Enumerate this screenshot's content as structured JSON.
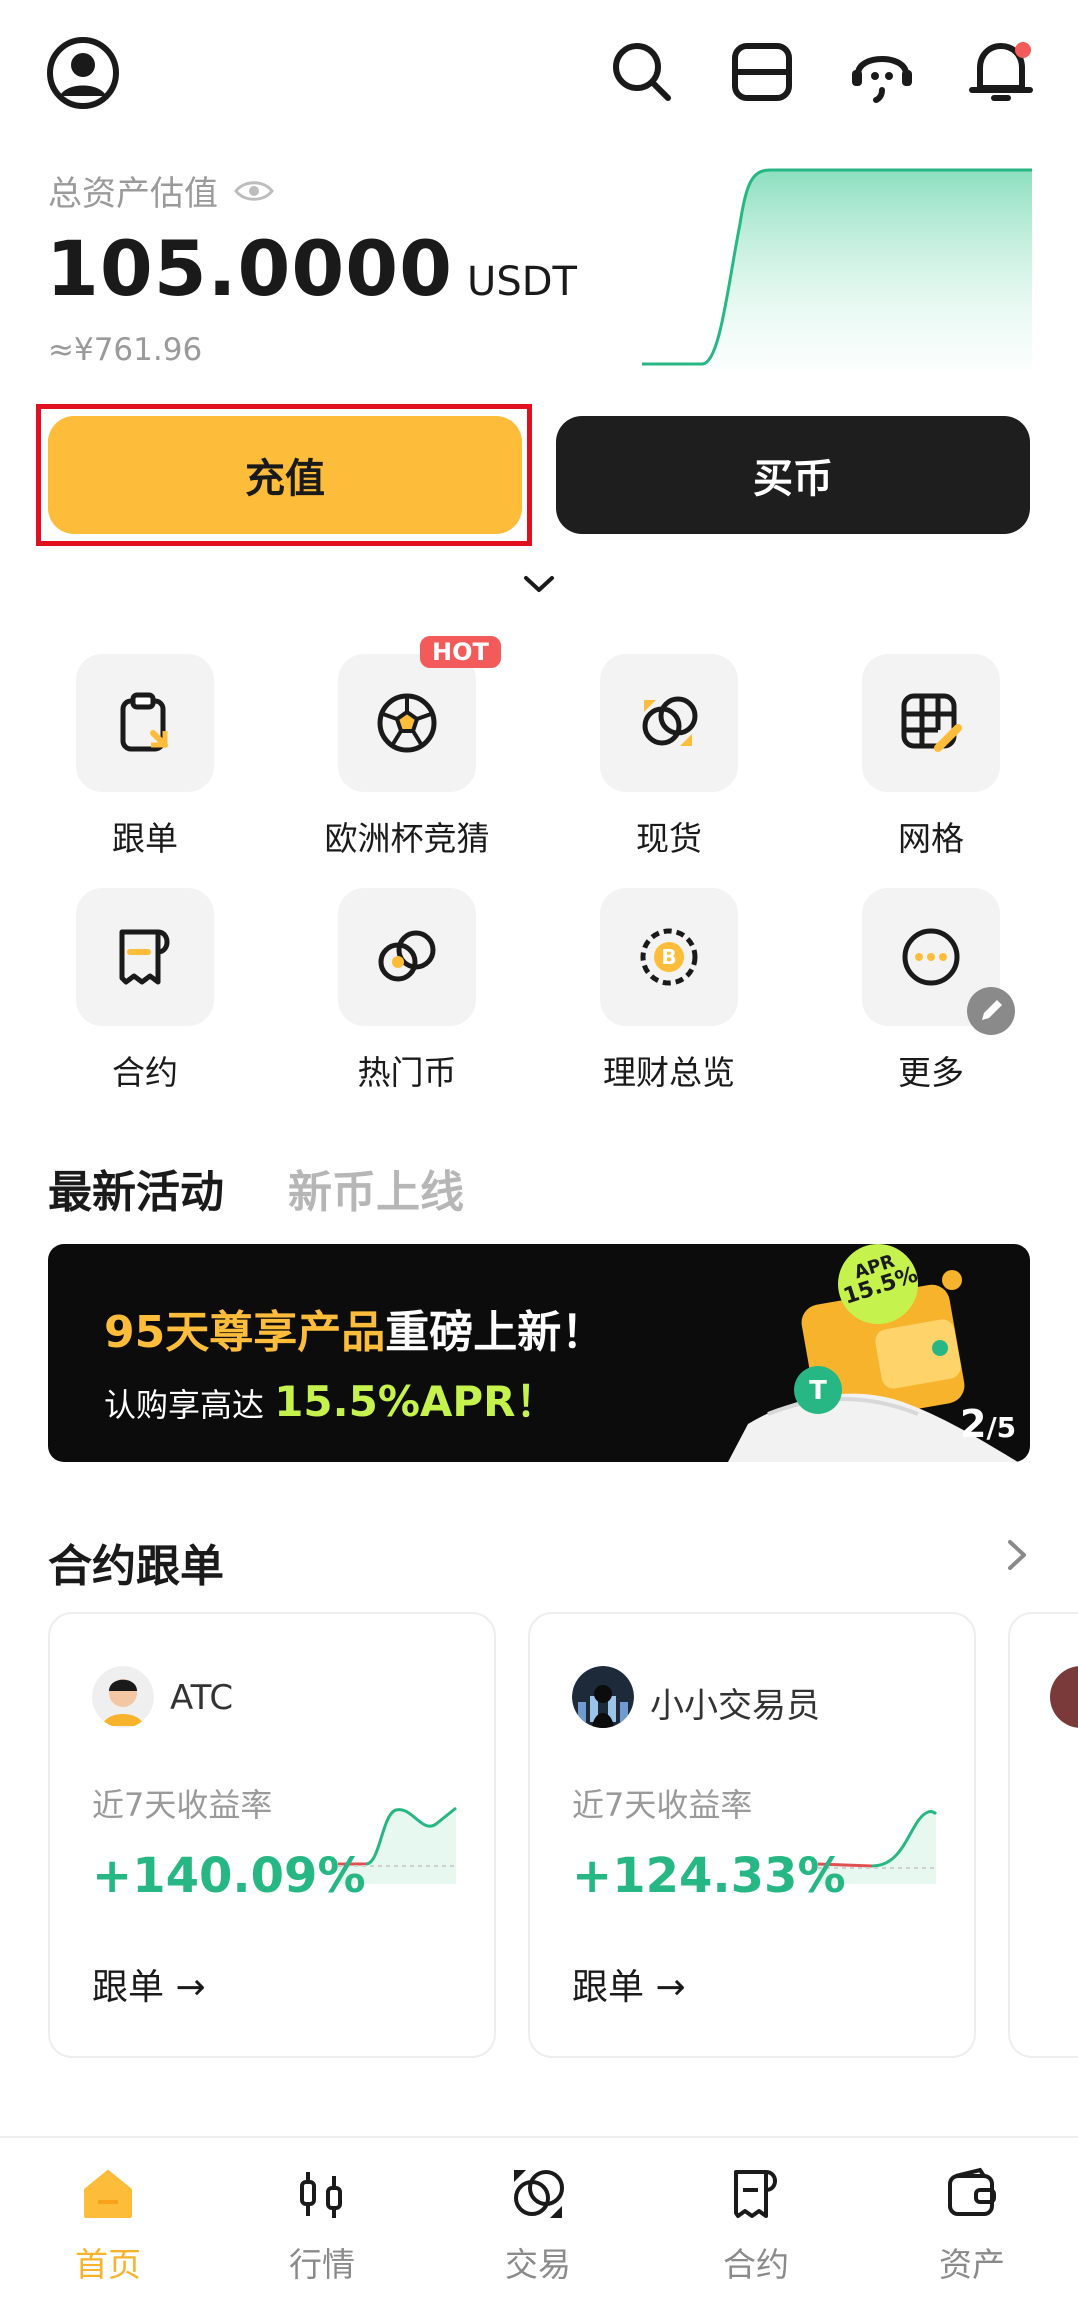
{
  "header": {
    "icons": [
      "user-icon",
      "search-icon",
      "scan-icon",
      "support-icon",
      "bell-icon"
    ]
  },
  "asset": {
    "label": "总资产估值",
    "value": "105.0000",
    "unit": "USDT",
    "cny": "≈¥761.96"
  },
  "actions": {
    "deposit": "充值",
    "buy": "买币"
  },
  "shortcuts": [
    {
      "label": "跟单",
      "icon": "clipboard-icon"
    },
    {
      "label": "欧洲杯竞猜",
      "icon": "soccer-ball-icon",
      "badge": "HOT"
    },
    {
      "label": "现货",
      "icon": "coins-icon"
    },
    {
      "label": "网格",
      "icon": "grid-icon"
    },
    {
      "label": "合约",
      "icon": "contract-icon"
    },
    {
      "label": "热门币",
      "icon": "hot-coins-icon"
    },
    {
      "label": "理财总览",
      "icon": "bitcoin-earn-icon"
    },
    {
      "label": "更多",
      "icon": "more-icon"
    }
  ],
  "feed_tabs": {
    "latest": "最新活动",
    "new_coins": "新币上线"
  },
  "banner": {
    "line1_highlight": "95天尊享产品",
    "line1_rest": "重磅上新！",
    "line2_prefix": "认购享高达 ",
    "line2_highlight": "15.5%APR！",
    "badge_top": "APR",
    "badge_value": "15.5%",
    "page_current": "2",
    "page_total": "/5"
  },
  "copy_trading": {
    "title": "合约跟单",
    "cards": [
      {
        "name": "ATC",
        "rate_label": "近7天收益率",
        "rate": "+140.09%",
        "follow": "跟单 →"
      },
      {
        "name": "小小交易员",
        "rate_label": "近7天收益率",
        "rate": "+124.33%",
        "follow": "跟单 →"
      }
    ]
  },
  "bottom_nav": [
    {
      "label": "首页",
      "icon": "home-icon",
      "active": true
    },
    {
      "label": "行情",
      "icon": "candlestick-icon"
    },
    {
      "label": "交易",
      "icon": "trade-icon"
    },
    {
      "label": "合约",
      "icon": "contract-icon"
    },
    {
      "label": "资产",
      "icon": "wallet-icon"
    }
  ],
  "colors": {
    "accent": "#fdbd3b",
    "positive": "#27b784",
    "hot_badge": "#f35a5a",
    "highlight_frame": "#e01020"
  }
}
